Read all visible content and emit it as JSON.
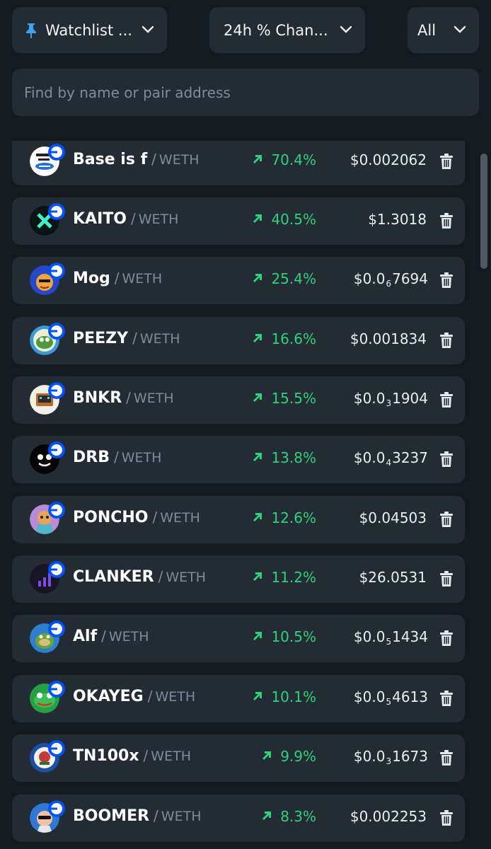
{
  "filters": {
    "watchlist_label": "Watchlist ...",
    "change_label": "24h % Chan...",
    "all_label": "All"
  },
  "search": {
    "value": "",
    "placeholder": "Find by name or pair address"
  },
  "colors": {
    "background": "#131a20",
    "card": "#232c35",
    "positive": "#2fd27a",
    "muted_text": "#7f8b97"
  },
  "tokens": [
    {
      "symbol": "Base is f",
      "separator": "/",
      "pair": "WETH",
      "change": "70.4%",
      "price_prefix": "$0.002062",
      "price_sub": "",
      "price_suffix": "",
      "logo": "base-logo"
    },
    {
      "symbol": "KAITO",
      "separator": "/",
      "pair": "WETH",
      "change": "40.5%",
      "price_prefix": "$1.3018",
      "price_sub": "",
      "price_suffix": "",
      "logo": "kaito-logo"
    },
    {
      "symbol": "Mog",
      "separator": "/",
      "pair": "WETH",
      "change": "25.4%",
      "price_prefix": "$0.0",
      "price_sub": "6",
      "price_suffix": "7694",
      "logo": "mog-logo"
    },
    {
      "symbol": "PEEZY",
      "separator": "/",
      "pair": "WETH",
      "change": "16.6%",
      "price_prefix": "$0.001834",
      "price_sub": "",
      "price_suffix": "",
      "logo": "peezy-logo"
    },
    {
      "symbol": "BNKR",
      "separator": "/",
      "pair": "WETH",
      "change": "15.5%",
      "price_prefix": "$0.0",
      "price_sub": "3",
      "price_suffix": "1904",
      "logo": "bnkr-logo"
    },
    {
      "symbol": "DRB",
      "separator": "/",
      "pair": "WETH",
      "change": "13.8%",
      "price_prefix": "$0.0",
      "price_sub": "4",
      "price_suffix": "3237",
      "logo": "drb-logo"
    },
    {
      "symbol": "PONCHO",
      "separator": "/",
      "pair": "WETH",
      "change": "12.6%",
      "price_prefix": "$0.04503",
      "price_sub": "",
      "price_suffix": "",
      "logo": "poncho-logo"
    },
    {
      "symbol": "CLANKER",
      "separator": "/",
      "pair": "WETH",
      "change": "11.2%",
      "price_prefix": "$26.0531",
      "price_sub": "",
      "price_suffix": "",
      "logo": "clanker-logo"
    },
    {
      "symbol": "Alf",
      "separator": "/",
      "pair": "WETH",
      "change": "10.5%",
      "price_prefix": "$0.0",
      "price_sub": "5",
      "price_suffix": "1434",
      "logo": "alf-logo"
    },
    {
      "symbol": "OKAYEG",
      "separator": "/",
      "pair": "WETH",
      "change": "10.1%",
      "price_prefix": "$0.0",
      "price_sub": "5",
      "price_suffix": "4613",
      "logo": "okayeg-logo"
    },
    {
      "symbol": "TN100x",
      "separator": "/",
      "pair": "WETH",
      "change": "9.9%",
      "price_prefix": "$0.0",
      "price_sub": "3",
      "price_suffix": "1673",
      "logo": "tn100x-logo"
    },
    {
      "symbol": "BOOMER",
      "separator": "/",
      "pair": "WETH",
      "change": "8.3%",
      "price_prefix": "$0.002253",
      "price_sub": "",
      "price_suffix": "",
      "logo": "boomer-logo"
    }
  ]
}
